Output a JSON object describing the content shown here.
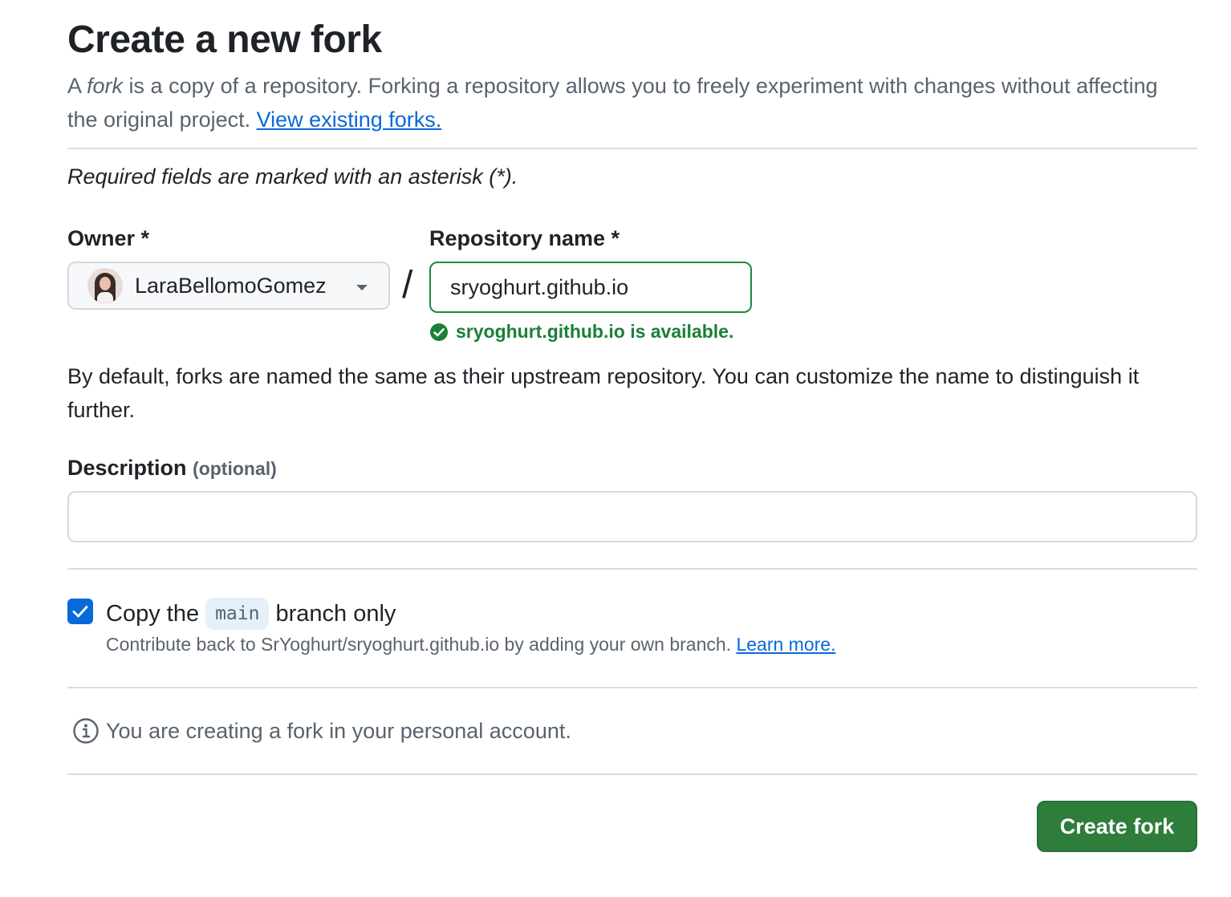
{
  "page": {
    "title": "Create a new fork",
    "intro_prefix": "A ",
    "intro_fork": "fork",
    "intro_rest": " is a copy of a repository. Forking a repository allows you to freely experiment with changes without affecting the original project. ",
    "view_forks_link": "View existing forks.",
    "required_note": "Required fields are marked with an asterisk (*)."
  },
  "form": {
    "owner_label": "Owner *",
    "owner_value": "LaraBellomoGomez",
    "slash": "/",
    "repo_label": "Repository name *",
    "repo_value": "sryoghurt.github.io",
    "availability": "sryoghurt.github.io is available.",
    "help_text": "By default, forks are named the same as their upstream repository. You can customize the name to distinguish it further.",
    "description_label": "Description",
    "description_optional": "(optional)",
    "description_value": "",
    "copy_prefix": "Copy the",
    "copy_branch": "main",
    "copy_suffix": "branch only",
    "copy_checked": true,
    "copy_help": "Contribute back to SrYoghurt/sryoghurt.github.io by adding your own branch. ",
    "learn_more": "Learn more.",
    "personal_note": "You are creating a fork in your personal account.",
    "create_button": "Create fork"
  },
  "colors": {
    "accent": "#0969da",
    "success": "#1a7f37",
    "button": "#2e7d3b"
  },
  "icons": {
    "availability": "check-circle-icon",
    "info": "info-icon",
    "dropdown": "triangle-down-icon",
    "checkbox": "checkmark-icon"
  }
}
